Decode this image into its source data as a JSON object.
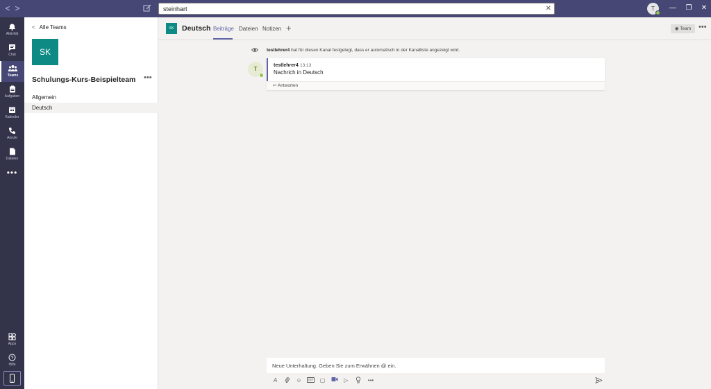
{
  "titlebar": {
    "back_arrow": "<",
    "forward_arrow": ">",
    "search_value": "steinhart",
    "search_clear": "✕",
    "avatar_initial": "T",
    "minimize": "—",
    "maximize": "❐",
    "close": "✕"
  },
  "rail": {
    "items": [
      {
        "label": "Aktivität",
        "icon": "bell-icon"
      },
      {
        "label": "Chat",
        "icon": "chat-icon"
      },
      {
        "label": "Teams",
        "icon": "teams-icon"
      },
      {
        "label": "Aufgaben",
        "icon": "assignments-icon"
      },
      {
        "label": "Kalender",
        "icon": "calendar-icon"
      },
      {
        "label": "Anrufe",
        "icon": "phone-icon"
      },
      {
        "label": "Dateien",
        "icon": "files-icon"
      }
    ],
    "more": "•••",
    "bottom": [
      {
        "label": "Apps",
        "icon": "apps-icon"
      },
      {
        "label": "Hilfe",
        "icon": "help-icon"
      }
    ]
  },
  "leftpanel": {
    "back_label": "Alle Teams",
    "team_initials": "SK",
    "team_name": "Schulungs-Kurs-Beispielteam",
    "team_more": "•••",
    "channels": [
      "Allgemein",
      "Deutsch"
    ],
    "selected_channel": "Deutsch"
  },
  "header": {
    "team_initials": "SK",
    "channel_name": "Deutsch",
    "tabs": [
      "Beiträge",
      "Dateien",
      "Notizen"
    ],
    "active_tab": "Beiträge",
    "add_tab": "+",
    "team_button": "Team",
    "more": "•••"
  },
  "feed": {
    "system_author": "testlehrer4",
    "system_text": "hat für diesen Kanal festgelegt, dass er automatisch in der Kanalliste angezeigt wird.",
    "message": {
      "avatar_initial": "T",
      "author": "testlehrer4",
      "time": "13:13",
      "text": "Nachrich in Deutsch",
      "reply_label": "Antworten",
      "reply_icon": "↩"
    }
  },
  "compose": {
    "placeholder": "Neue Unterhaltung. Geben Sie zum Erwähnen @ ein.",
    "tools": [
      {
        "icon": "format-icon",
        "glyph": "A"
      },
      {
        "icon": "attach-icon",
        "glyph": "📎"
      },
      {
        "icon": "emoji-icon",
        "glyph": "☺"
      },
      {
        "icon": "gif-icon",
        "glyph": "GIF"
      },
      {
        "icon": "sticker-icon",
        "glyph": "▢"
      },
      {
        "icon": "meet-now-icon",
        "glyph": "■"
      },
      {
        "icon": "stream-icon",
        "glyph": "▷"
      },
      {
        "icon": "praise-icon",
        "glyph": "♀"
      },
      {
        "icon": "more-options-icon",
        "glyph": "•••"
      }
    ]
  },
  "colors": {
    "titlebar": "#464775",
    "rail": "#33344a",
    "accent": "#6264a7",
    "team_tile": "#0e8a84",
    "presence": "#92c353"
  }
}
